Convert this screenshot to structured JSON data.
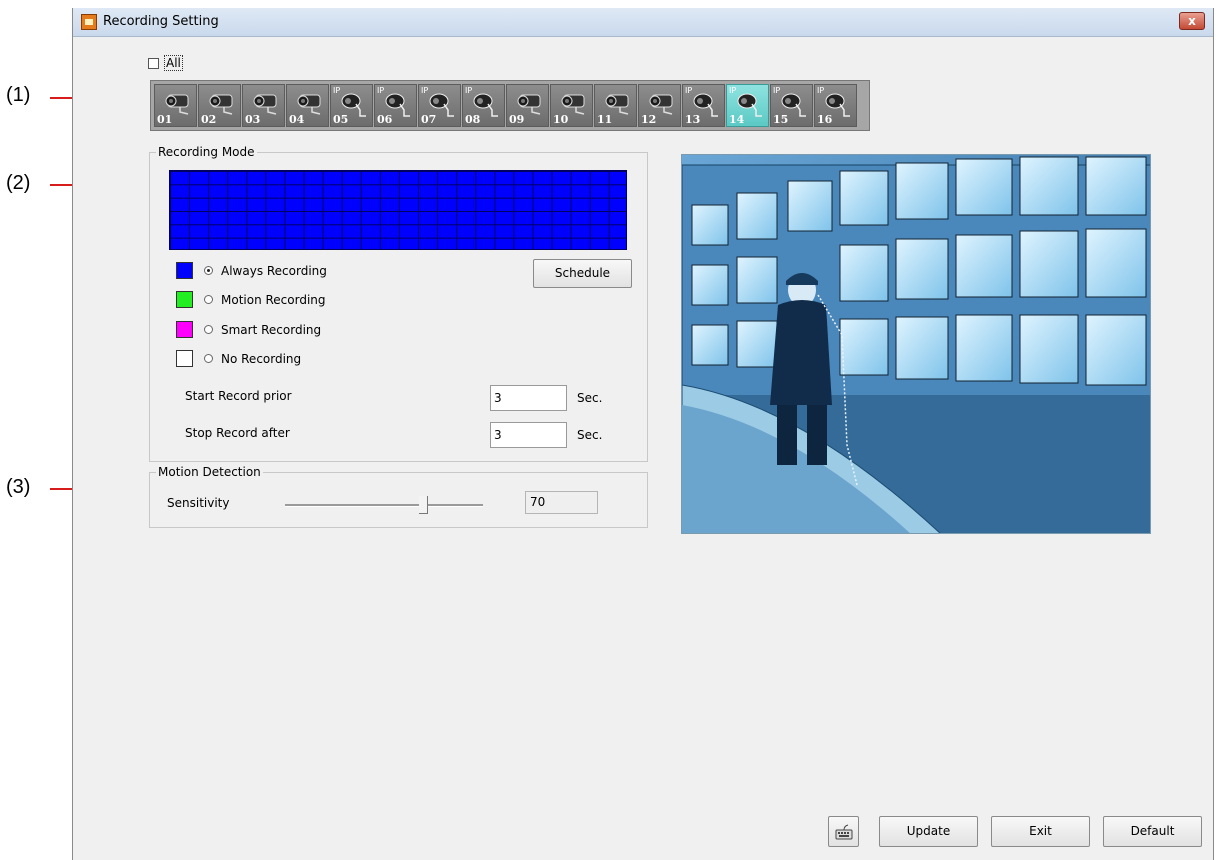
{
  "callouts": [
    "(1)",
    "(2)",
    "(3)"
  ],
  "window": {
    "title": "Recording Setting",
    "close_label": "x"
  },
  "select_all": {
    "label": "All",
    "checked": false
  },
  "cameras": [
    {
      "label": "01",
      "type": "analog"
    },
    {
      "label": "02",
      "type": "analog"
    },
    {
      "label": "03",
      "type": "analog"
    },
    {
      "label": "04",
      "type": "analog"
    },
    {
      "label": "05",
      "type": "ip"
    },
    {
      "label": "06",
      "type": "ip"
    },
    {
      "label": "07",
      "type": "ip"
    },
    {
      "label": "08",
      "type": "ip"
    },
    {
      "label": "09",
      "type": "analog"
    },
    {
      "label": "10",
      "type": "analog"
    },
    {
      "label": "11",
      "type": "analog"
    },
    {
      "label": "12",
      "type": "analog"
    },
    {
      "label": "13",
      "type": "ip"
    },
    {
      "label": "14",
      "type": "ip",
      "selected": true
    },
    {
      "label": "15",
      "type": "ip"
    },
    {
      "label": "16",
      "type": "ip"
    }
  ],
  "ip_badge": "IP",
  "recording_mode": {
    "legend": "Recording Mode",
    "schedule_color": "#0000ff",
    "options": [
      {
        "label": "Always Recording",
        "color": "#0000ff",
        "selected": true
      },
      {
        "label": "Motion Recording",
        "color": "#22ee22",
        "selected": false
      },
      {
        "label": "Smart Recording",
        "color": "#ff00ff",
        "selected": false
      },
      {
        "label": "No Recording",
        "color": "#ffffff",
        "selected": false
      }
    ],
    "schedule_button": "Schedule",
    "start_prior": {
      "label": "Start Record prior",
      "value": "3",
      "unit": "Sec."
    },
    "stop_after": {
      "label": "Stop Record after",
      "value": "3",
      "unit": "Sec."
    }
  },
  "motion_detection": {
    "legend": "Motion Detection",
    "sensitivity_label": "Sensitivity",
    "sensitivity_value": "70"
  },
  "buttons": {
    "update": "Update",
    "exit": "Exit",
    "default": "Default",
    "keyboard_icon": "keyboard-icon"
  }
}
